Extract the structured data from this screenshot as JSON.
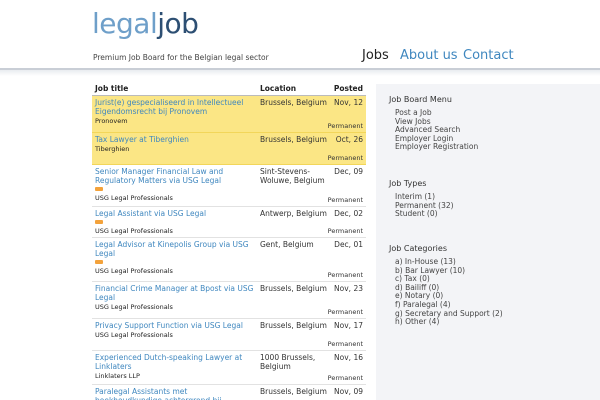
{
  "header": {
    "logo_part1": "legal",
    "logo_part2": "job",
    "tagline": "Premium Job Board for the Belgian legal sector"
  },
  "nav": {
    "jobs": "Jobs",
    "about": "About us",
    "contact": "Contact"
  },
  "table": {
    "columns": {
      "title": "Job title",
      "location": "Location",
      "posted": "Posted"
    },
    "rows": [
      {
        "title": "Jurist(e) gespecialiseerd in Intellectueel Eigendomsrecht bij Pronovem",
        "company": "Pronovem",
        "location": "Brussels, Belgium",
        "date": "Nov, 12",
        "type": "Permanent",
        "highlight": true,
        "rss": false
      },
      {
        "title": "Tax Lawyer at Tiberghien",
        "company": "Tiberghien",
        "location": "Brussels, Belgium",
        "date": "Oct, 26",
        "type": "Permanent",
        "highlight": true,
        "rss": false
      },
      {
        "title": "Senior Manager Financial Law and Regulatory Matters via USG Legal",
        "company": "USG Legal Professionals",
        "location": "Sint-Stevens-Woluwe, Belgium",
        "date": "Dec, 09",
        "type": "Permanent",
        "highlight": false,
        "rss": true
      },
      {
        "title": "Legal Assistant via USG Legal",
        "company": "USG Legal Professionals",
        "location": "Antwerp, Belgium",
        "date": "Dec, 02",
        "type": "Permanent",
        "highlight": false,
        "rss": true
      },
      {
        "title": "Legal Advisor at Kinepolis Group via USG Legal",
        "company": "USG Legal Professionals",
        "location": "Gent, Belgium",
        "date": "Dec, 01",
        "type": "Permanent",
        "highlight": false,
        "rss": true
      },
      {
        "title": "Financial Crime Manager at Bpost via USG Legal",
        "company": "USG Legal Professionals",
        "location": "Brussels, Belgium",
        "date": "Nov, 23",
        "type": "Permanent",
        "highlight": false,
        "rss": false
      },
      {
        "title": "Privacy Support Function via USG Legal",
        "company": "USG Legal Professionals",
        "location": "Brussels, Belgium",
        "date": "Nov, 17",
        "type": "Permanent",
        "highlight": false,
        "rss": false
      },
      {
        "title": "Experienced Dutch-speaking Lawyer at Linklaters",
        "company": "Linklaters LLP",
        "location": "1000 Brussels, Belgium",
        "date": "Nov, 16",
        "type": "Permanent",
        "highlight": false,
        "rss": false
      },
      {
        "title": "Paralegal Assistants met boekhoudkundige achtergrond bij Tiberghien",
        "company": "",
        "location": "Brussels, Belgium",
        "date": "Nov, 09",
        "type": "",
        "highlight": false,
        "rss": false
      }
    ]
  },
  "sidebar": {
    "menu_heading": "Job Board Menu",
    "menu_items": [
      "Post a Job",
      "View Jobs",
      "Advanced Search",
      "Employer Login",
      "Employer Registration"
    ],
    "types_heading": "Job Types",
    "types_items": [
      "Interim (1)",
      "Permanent (32)",
      "Student (0)"
    ],
    "categories_heading": "Job Categories",
    "categories_items": [
      "a) In-House (13)",
      "b) Bar Lawyer (10)",
      "c) Tax (0)",
      "d) Bailiff (0)",
      "e) Notary (0)",
      "f) Paralegal (4)",
      "g) Secretary and Support (2)",
      "h) Other (4)"
    ]
  },
  "colors": {
    "link": "#3f87bf",
    "highlight_row": "#fbe685",
    "sidebar_bg": "#f3f4f7",
    "logo_light": "#6e9fc9",
    "logo_dark": "#2d4f73"
  }
}
